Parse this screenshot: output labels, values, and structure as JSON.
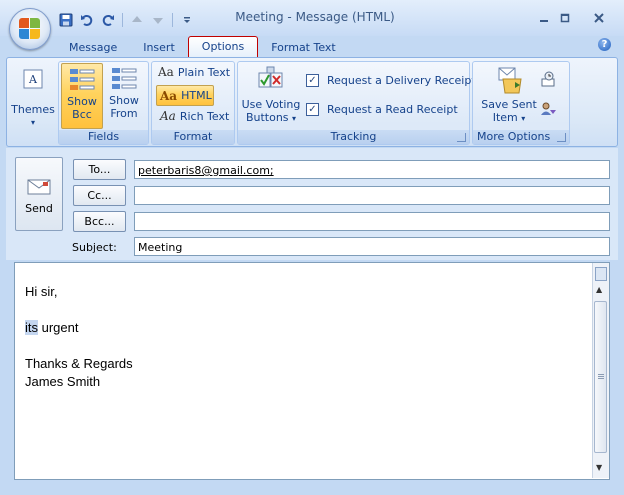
{
  "window": {
    "title": "Meeting - Message (HTML)"
  },
  "quick_access": [
    "save-icon",
    "undo-icon",
    "redo-icon",
    "previous-item-icon",
    "next-item-icon",
    "customize-icon"
  ],
  "tabs": [
    {
      "label": "Message",
      "active": false
    },
    {
      "label": "Insert",
      "active": false
    },
    {
      "label": "Options",
      "active": true
    },
    {
      "label": "Format Text",
      "active": false
    }
  ],
  "ribbon": {
    "themes": {
      "label": "Themes"
    },
    "fields": {
      "group_label": "Fields",
      "show_bcc": {
        "line1": "Show",
        "line2": "Bcc"
      },
      "show_from": {
        "line1": "Show",
        "line2": "From"
      }
    },
    "format": {
      "group_label": "Format",
      "plain_text": "Plain Text",
      "html": "HTML",
      "rich_text": "Rich Text"
    },
    "tracking": {
      "group_label": "Tracking",
      "voting": {
        "line1": "Use Voting",
        "line2": "Buttons"
      },
      "delivery_receipt": {
        "label": "Request a Delivery Receipt",
        "checked": true
      },
      "read_receipt": {
        "label": "Request a Read Receipt",
        "checked": true
      }
    },
    "more_options": {
      "group_label": "More Options",
      "save_sent": {
        "line1": "Save Sent",
        "line2": "Item"
      }
    }
  },
  "message": {
    "send_label": "Send",
    "to_label": "To...",
    "cc_label": "Cc...",
    "bcc_label": "Bcc...",
    "subject_label": "Subject:",
    "to_value": "peterbaris8@gmail.com;",
    "cc_value": "",
    "bcc_value": "",
    "subject_value": "Meeting",
    "body": {
      "line1": "Hi sir,",
      "line2_highlight": "its",
      "line2_rest": " urgent",
      "line3": "Thanks & Regards",
      "line4": "James Smith"
    }
  },
  "colors": {
    "accent": "#15428b",
    "tab_highlight": "#c00000",
    "selected": "#ffd35e"
  }
}
